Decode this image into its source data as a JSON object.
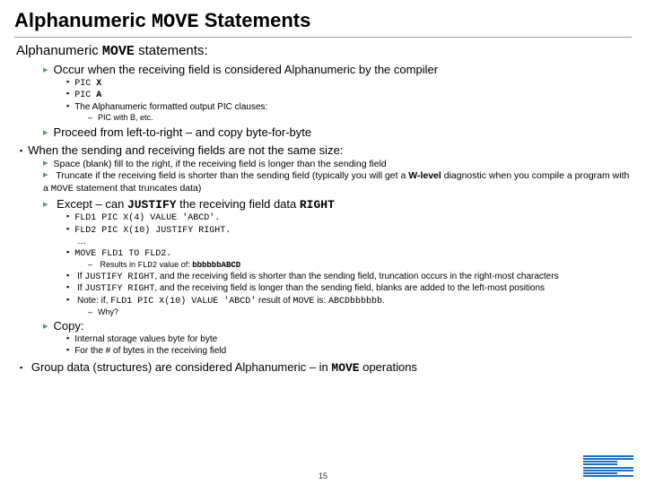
{
  "title": {
    "pre": "Alphanumeric ",
    "code": "MOVE",
    "post": " Statements"
  },
  "subtitle": {
    "pre": "Alphanumeric ",
    "code": "MOVE",
    "post": " statements:"
  },
  "occur": {
    "text": "Occur when the receiving field is considered Alphanumeric by the compiler",
    "items": {
      "picx_pre": "PIC ",
      "picx_b": "X",
      "pica_pre": "PIC ",
      "pica_b": "A",
      "fmt": "The Alphanumeric formatted output PIC clauses:",
      "fmt_sub": "PIC with B, etc."
    }
  },
  "proceed": "Proceed from left-to-right – and copy byte-for-byte",
  "notsame": {
    "heading": "When the sending and receiving fields are not the same size:",
    "space": "Space (blank) fill to the right, if the receiving field is longer than the sending field",
    "trunc_a": "Truncate if the receiving field is shorter than the sending field (typically you will get a ",
    "trunc_b": "W-level",
    "trunc_c": " diagnostic when you compile a program with a ",
    "trunc_code": "MOVE",
    "trunc_d": " statement that truncates data)",
    "except_pre": "Except – can ",
    "except_code": "JUSTIFY",
    "except_mid": " the receiving field data ",
    "except_code2": "RIGHT",
    "fld1": "FLD1   PIC X(4) VALUE 'ABCD'.",
    "fld2": "FLD2   PIC X(10) JUSTIFY RIGHT.",
    "dots": "…",
    "move": "MOVE   FLD1 TO FLD2.",
    "result_a": "Results in ",
    "result_code": "FLD2",
    "result_b": " value of:  ",
    "result_val": "bbbbbbABCD",
    "jr_short_a": "If ",
    "jr_short_code": "JUSTIFY RIGHT",
    "jr_short_b": ", and the receiving field is shorter than the sending field, truncation occurs in the right-most characters",
    "jr_long_a": "If ",
    "jr_long_code": "JUSTIFY RIGHT",
    "jr_long_b": ", and the receiving field is longer than the sending field, blanks are added to the left-most positions",
    "note_a": "Note: if, ",
    "note_code1": "FLD1   PIC X(10) VALUE 'ABCD'",
    "note_b": " result of ",
    "note_code2": "MOVE",
    "note_c": " is: ",
    "note_code3": "ABCDbbbbbb",
    "note_dot": ".",
    "why": "Why?"
  },
  "copy": {
    "heading": "Copy:",
    "a": "Internal storage values byte for byte",
    "b": "For the # of bytes in the receiving field"
  },
  "group": {
    "a": "Group data (structures) are considered Alphanumeric – in ",
    "code": "MOVE",
    "b": " operations"
  },
  "page": "15",
  "logo_alt": "IBM"
}
